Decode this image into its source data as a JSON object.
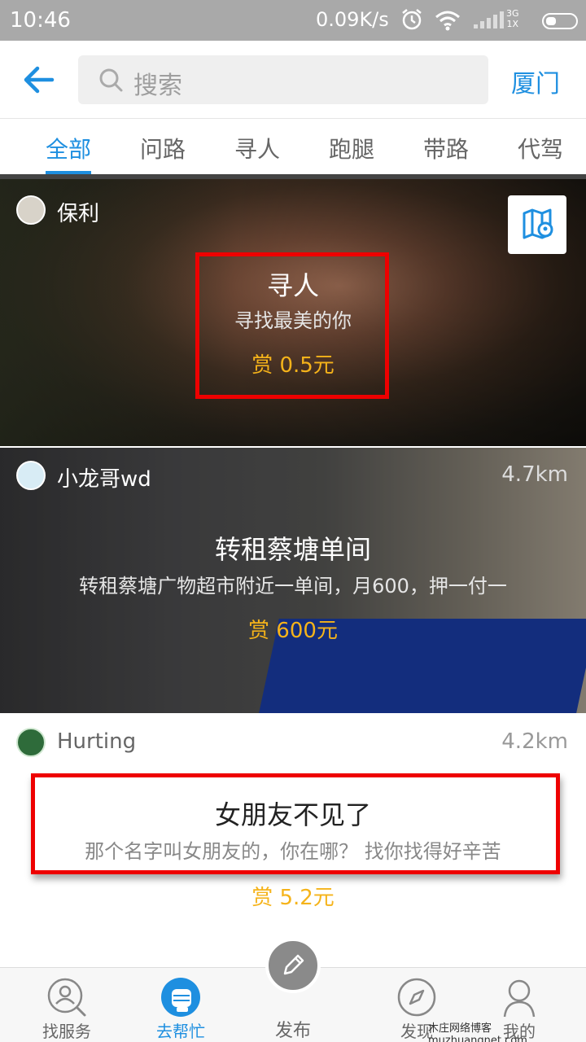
{
  "status_bar": {
    "time": "10:46",
    "speed": "0.09K/s",
    "net_top": "3G",
    "net_bottom": "1X"
  },
  "header": {
    "search_placeholder": "搜索",
    "city": "厦门"
  },
  "tabs": [
    {
      "label": "全部",
      "active": true
    },
    {
      "label": "问路",
      "active": false
    },
    {
      "label": "寻人",
      "active": false
    },
    {
      "label": "跑腿",
      "active": false
    },
    {
      "label": "带路",
      "active": false
    },
    {
      "label": "代驾",
      "active": false
    }
  ],
  "cards": [
    {
      "user": "保利",
      "distance": "",
      "title": "寻人",
      "desc": "寻找最美的你",
      "reward": "赏 0.5元"
    },
    {
      "user": "小龙哥wd",
      "distance": "4.7km",
      "title": "转租蔡塘单间",
      "desc": "转租蔡塘广物超市附近一单间，月600，押一付一",
      "reward": "赏 600元"
    },
    {
      "user": "Hurting",
      "distance": "4.2km",
      "title": "女朋友不见了",
      "desc": "那个名字叫女朋友的，你在哪？   找你找得好辛苦",
      "reward": "赏 5.2元"
    }
  ],
  "bottom_nav": [
    {
      "label": "找服务",
      "icon": "search-person-icon",
      "active": false
    },
    {
      "label": "去帮忙",
      "icon": "fist-icon",
      "active": true
    },
    {
      "label": "发布",
      "icon": "pencil-icon",
      "active": false
    },
    {
      "label": "发现",
      "icon": "compass-icon",
      "active": false
    },
    {
      "label": "我的",
      "icon": "user-icon",
      "active": false
    }
  ],
  "watermark": "木庄网络博客 muzhuangnet.com",
  "colors": {
    "accent": "#1e8fe0",
    "reward": "#f5b31a",
    "highlight": "#ee0000"
  }
}
